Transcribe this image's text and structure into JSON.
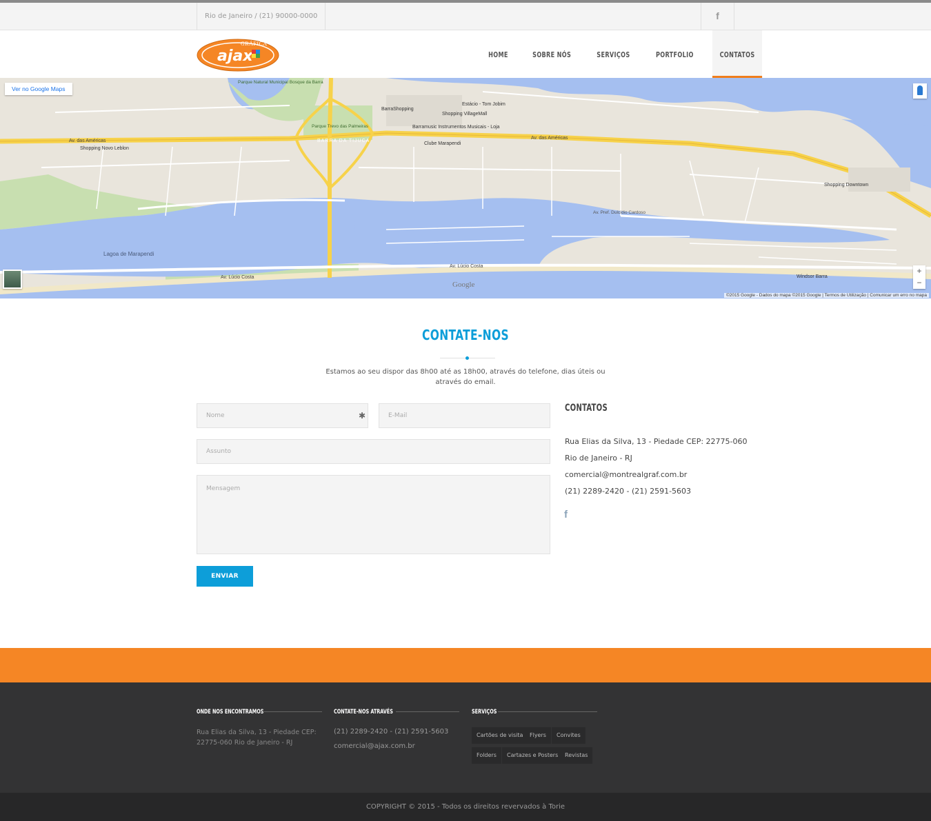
{
  "topbar": {
    "info": "Rio de Janeiro / (21) 90000-0000",
    "facebook_icon": "f"
  },
  "header": {
    "logo_text": "ajax",
    "logo_top_text": "GRÁFICA",
    "nav": [
      "HOME",
      "SOBRE NÓS",
      "SERVIÇOS",
      "PORTFOLIO",
      "CONTATOS"
    ],
    "active": "CONTATOS"
  },
  "map": {
    "view_link": "Ver no Google Maps",
    "attribution": "©2015 Google - Dados do mapa ©2015 Google | Termos de Utilização | Comunicar um erro no mapa",
    "zoom_in": "+",
    "zoom_out": "−",
    "brand": "Google",
    "labels": {
      "park": "Parque Natural Municipal Bosque da Barra",
      "trevo": "Parque Trevo das Palmeiras",
      "barra": "BARRA DA TIJUCA",
      "americas": "Av. das Américas",
      "lagoa": "Lagoa de Marapendi",
      "lucio": "Av. Lúcio Costa",
      "dulcidio": "Av. Pref. Dulcídio Cardoso",
      "barrashopping": "BarraShopping",
      "village": "Shopping VillageMall",
      "estacio": "Estácio - Tom Jobim",
      "leblon": "Shopping Novo Leblon",
      "downtown": "Shopping Downtown",
      "marapendi": "Clube Marapendi",
      "barramusic": "Barramusic Instrumentos Musicais - Loja",
      "windsor": "Windsor Barra"
    }
  },
  "contact": {
    "title": "CONTATE-NOS",
    "intro": "Estamos ao seu dispor das 8h00 até as 18h00, através do telefone, dias úteis ou através do email.",
    "form": {
      "name_placeholder": "Nome",
      "email_placeholder": "E-Mail",
      "subject_placeholder": "Assunto",
      "message_placeholder": "Mensagem",
      "required_mark": "✱",
      "submit": "ENVIAR"
    },
    "contacts_title": "CONTATOS",
    "address": "Rua Elias da Silva, 13 - Piedade CEP: 22775-060",
    "city": "Rio de Janeiro - RJ",
    "email": "comercial@montrealgraf.com.br",
    "phones": "(21) 2289-2420 - (21) 2591-5603",
    "facebook_icon": "f"
  },
  "footer": {
    "col1_title": "ONDE NOS ENCONTRAMOS",
    "col1_text": "Rua Elias da Silva, 13 - Piedade CEP: 22775-060 Rio de Janeiro - RJ",
    "col2_title": "CONTATE-NOS ATRAVÉS",
    "col2_phone": "(21) 2289-2420 - (21) 2591-5603",
    "col2_email": "comercial@ajax.com.br",
    "col3_title": "SERVIÇOS",
    "tags": [
      "Cartões de visita",
      "Flyers",
      "Convites",
      "Folders",
      "Cartazes e Posters",
      "Revistas"
    ],
    "copyright": "COPYRIGHT © 2015 - Todos os direitos revervados à Torie"
  },
  "colors": {
    "accent_blue": "#0d9ed9",
    "accent_orange": "#f58625",
    "footer_dark": "#333334"
  }
}
